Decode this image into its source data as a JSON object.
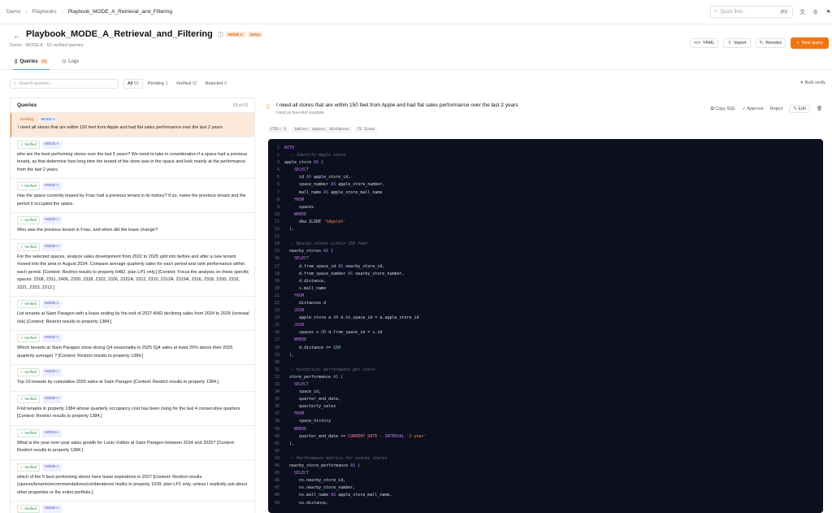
{
  "breadcrumb": [
    "Demo",
    "Playbooks",
    "Playbook_MODE_A_Retrieval_and_Filtering"
  ],
  "topbar": {
    "quick_find_placeholder": "Quick find...",
    "shortcut": "⌘K"
  },
  "header": {
    "title": "Playbook_MODE_A_Retrieval_and_Filtering",
    "badge_mode": "MODE A",
    "badge_demo": "Demo",
    "subtitle": "Demo · MODE A · 52 verified queries",
    "actions": {
      "yaml": "YAML",
      "import": "Import",
      "reindex": "Reindex",
      "new_query": "New query"
    }
  },
  "tabs": [
    {
      "label": "Queries",
      "count": "53"
    },
    {
      "label": "Logs"
    }
  ],
  "filters": {
    "search_placeholder": "Search queries...",
    "segments": [
      {
        "label": "All",
        "count": "53"
      },
      {
        "label": "Pending",
        "count": "1"
      },
      {
        "label": "Verified",
        "count": "52"
      },
      {
        "label": "Rejected",
        "count": "0"
      }
    ],
    "bulk_verify": "Bulk verify"
  },
  "list": {
    "title": "Queries",
    "count": "53 of 53",
    "items": [
      {
        "status": "Pending",
        "mode": "MODE A",
        "text": "I need all stores that are within 150 feet from Apple and had flat sales performance over the last 2 years"
      },
      {
        "status": "✓ Verified",
        "mode": "MODE A",
        "text": "who are the best performing stores over the last 5 years? We need to take in consideration if a space had a previous tenant, as that determine how long time the tenant of the store was in the space and look mainly at the performance from the last 2 years"
      },
      {
        "status": "✓ Verified",
        "mode": "MODE A",
        "text": "Has the space currently leased by Fnac had a previous tenant in its history? If so, name the previous tenant and the period it occupied the space."
      },
      {
        "status": "✓ Verified",
        "mode": "MODE A",
        "text": "Who was the previous tenant in Fnac, and when did the lease change?"
      },
      {
        "status": "✓ Verified",
        "mode": "MODE A",
        "text": "For the selected spaces, analyze sales development from 2022 to 2025 split into before and after a new tenant moved into the area in August 2024. Compare average quarterly sales for each period and rank performance within each period. [Context: Restrict results to property 6482, plan LP1 only.] [Context: Focus the analysis on these specific spaces: 2308, 2311, 2406, 2320, 2328, 2322, 2326, 2322A, 2312, 2310, 2312A, 2319A, 2316, 2318, 2330, 2332, 2321, 2323, 2313.]"
      },
      {
        "status": "✓ Verified",
        "mode": "MODE A",
        "text": "List tenants at Siam Paragon with a lease ending by the end of 2027 AND declining sales from 2024 to 2025 (renewal risk) [Context: Restrict results to property 1384.]"
      },
      {
        "status": "✓ Verified",
        "mode": "MODE A",
        "text": "Which tenants at Siam Paragon show strong Q4 seasonality in 2025 (Q4 sales at least 20% above their 2025 quarterly average) ? [Context: Restrict results to property 1384.]"
      },
      {
        "status": "✓ Verified",
        "mode": "MODE A",
        "text": "Top 10 tenants by cumulative 2025 sales at Siam Paragon [Context: Restrict results to property 1384.]"
      },
      {
        "status": "✓ Verified",
        "mode": "MODE A",
        "text": "Find tenants in property 1384 whose quarterly occupancy cost has been rising for the last 4 consecutive quarters [Context: Restrict results to property 1384.]"
      },
      {
        "status": "✓ Verified",
        "mode": "MODE A",
        "text": "What is the year-over-year sales growth for Louis Vuitton at Siam Paragon between 2024 and 2025? [Context: Restrict results to property 1384.]"
      },
      {
        "status": "✓ Verified",
        "mode": "MODE A",
        "text": "which of the 5 best performing stores have lease expirations in 2027 [Context: Restrict results (spaces/tenants/recommendations/combinations/ malls) to property 1028, plan LP1 only, unless I explicitly ask about other properties or the entire portfolio.]"
      },
      {
        "status": "✓ Verified",
        "mode": "MODE A",
        "text": ""
      }
    ]
  },
  "detail": {
    "title": "I need all stores that are within 150 feet from Apple and had flat sales performance over the last 2 years",
    "subtitle": "Used as few-shot example",
    "actions": {
      "copy_sql": "Copy SQL",
      "approve": "Approve",
      "reject": "Reject",
      "edit": "Edit"
    },
    "meta": [
      "CTEs: 1",
      "tables: spaces, distances",
      "71 lines"
    ]
  },
  "code_lines": [
    [
      [
        "kw",
        "WITH"
      ]
    ],
    [
      [
        "id",
        "  "
      ],
      [
        "cm",
        "-- Identify Apple store"
      ]
    ],
    [
      [
        "id",
        "apple_store "
      ],
      [
        "kw",
        "AS"
      ],
      [
        "id",
        " ("
      ]
    ],
    [
      [
        "id",
        "    "
      ],
      [
        "kw",
        "SELECT"
      ]
    ],
    [
      [
        "id",
        "      id "
      ],
      [
        "kw",
        "AS"
      ],
      [
        "id",
        " apple_store_id,"
      ]
    ],
    [
      [
        "id",
        "      space_number "
      ],
      [
        "kw",
        "AS"
      ],
      [
        "id",
        " apple_store_number,"
      ]
    ],
    [
      [
        "id",
        "      mall_name "
      ],
      [
        "kw",
        "AS"
      ],
      [
        "id",
        " apple_store_mall_name"
      ]
    ],
    [
      [
        "id",
        "    "
      ],
      [
        "kw",
        "FROM"
      ]
    ],
    [
      [
        "id",
        "      spaces"
      ]
    ],
    [
      [
        "id",
        "    "
      ],
      [
        "kw",
        "WHERE"
      ]
    ],
    [
      [
        "id",
        "      dba ILIKE "
      ],
      [
        "st",
        "'%Apple%'"
      ]
    ],
    [
      [
        "id",
        "  ),"
      ]
    ],
    [
      [
        "id",
        ""
      ]
    ],
    [
      [
        "id",
        "  "
      ],
      [
        "cm",
        "-- Nearby stores within 150 feet"
      ]
    ],
    [
      [
        "id",
        "  nearby_stores "
      ],
      [
        "kw",
        "AS"
      ],
      [
        "id",
        " ("
      ]
    ],
    [
      [
        "id",
        "    "
      ],
      [
        "kw",
        "SELECT"
      ]
    ],
    [
      [
        "id",
        "      d.from_space_id "
      ],
      [
        "kw",
        "AS"
      ],
      [
        "id",
        " nearby_store_id,"
      ]
    ],
    [
      [
        "id",
        "      d.from_space_number "
      ],
      [
        "kw",
        "AS"
      ],
      [
        "id",
        " nearby_store_number,"
      ]
    ],
    [
      [
        "id",
        "      d.distance,"
      ]
    ],
    [
      [
        "id",
        "      s.mall_name"
      ]
    ],
    [
      [
        "id",
        "    "
      ],
      [
        "kw",
        "FROM"
      ]
    ],
    [
      [
        "id",
        "      distances d"
      ]
    ],
    [
      [
        "id",
        "    "
      ],
      [
        "kw",
        "JOIN"
      ]
    ],
    [
      [
        "id",
        "      apple_store a "
      ],
      [
        "kw",
        "ON"
      ],
      [
        "id",
        " d.to_space_id = a.apple_store_id"
      ]
    ],
    [
      [
        "id",
        "    "
      ],
      [
        "kw",
        "JOIN"
      ]
    ],
    [
      [
        "id",
        "      spaces s "
      ],
      [
        "kw",
        "ON"
      ],
      [
        "id",
        " d.from_space_id = s.id"
      ]
    ],
    [
      [
        "id",
        "    "
      ],
      [
        "kw",
        "WHERE"
      ]
    ],
    [
      [
        "id",
        "      d.distance <= "
      ],
      [
        "nm",
        "150"
      ]
    ],
    [
      [
        "id",
        "  ),"
      ]
    ],
    [
      [
        "id",
        ""
      ]
    ],
    [
      [
        "id",
        "  "
      ],
      [
        "cm",
        "-- Historical performance per store"
      ]
    ],
    [
      [
        "id",
        "  store_performance "
      ],
      [
        "kw",
        "AS"
      ],
      [
        "id",
        " ("
      ]
    ],
    [
      [
        "id",
        "    "
      ],
      [
        "kw",
        "SELECT"
      ]
    ],
    [
      [
        "id",
        "      space_id,"
      ]
    ],
    [
      [
        "id",
        "      quarter_end_date,"
      ]
    ],
    [
      [
        "id",
        "      quarterly_sales"
      ]
    ],
    [
      [
        "id",
        "    "
      ],
      [
        "kw",
        "FROM"
      ]
    ],
    [
      [
        "id",
        "      space_history"
      ]
    ],
    [
      [
        "id",
        "    "
      ],
      [
        "kw",
        "WHERE"
      ]
    ],
    [
      [
        "id",
        "      quarter_end_date >= "
      ],
      [
        "fn",
        "CURRENT_DATE"
      ],
      [
        "id",
        " - "
      ],
      [
        "kw",
        "INTERVAL"
      ],
      [
        "id",
        " "
      ],
      [
        "st",
        "'2 year'"
      ]
    ],
    [
      [
        "id",
        "  ),"
      ]
    ],
    [
      [
        "id",
        ""
      ]
    ],
    [
      [
        "id",
        "  "
      ],
      [
        "cm",
        "-- Performance metrics for nearby stores"
      ]
    ],
    [
      [
        "id",
        "  nearby_store_performance "
      ],
      [
        "kw",
        "AS"
      ],
      [
        "id",
        " ("
      ]
    ],
    [
      [
        "id",
        "    "
      ],
      [
        "kw",
        "SELECT"
      ]
    ],
    [
      [
        "id",
        "      ns.nearby_store_id,"
      ]
    ],
    [
      [
        "id",
        "      ns.nearby_store_number,"
      ]
    ],
    [
      [
        "id",
        "      ns.mall_name "
      ],
      [
        "kw",
        "AS"
      ],
      [
        "id",
        " apple_store_mall_name,"
      ]
    ],
    [
      [
        "id",
        "      ns.distance,"
      ]
    ]
  ]
}
